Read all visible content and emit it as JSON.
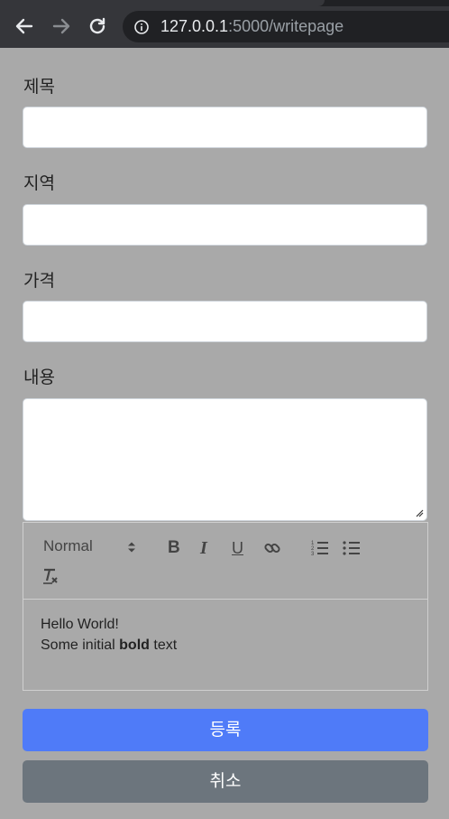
{
  "browser": {
    "url_host": "127.0.0.1",
    "url_path": ":5000/writepage"
  },
  "form": {
    "title_label": "제목",
    "region_label": "지역",
    "price_label": "가격",
    "content_label": "내용",
    "title_value": "",
    "region_value": "",
    "price_value": "",
    "content_value": ""
  },
  "editor": {
    "format_select": "Normal",
    "bold": "B",
    "italic": "I",
    "underline": "U",
    "line1": "Hello World!",
    "line2_prefix": "Some initial ",
    "line2_bold": "bold",
    "line2_suffix": " text"
  },
  "buttons": {
    "submit": "등록",
    "cancel": "취소"
  },
  "colors": {
    "page_bg": "#a9a9a9",
    "primary": "#4f7bf8",
    "secondary": "#6c757d"
  }
}
